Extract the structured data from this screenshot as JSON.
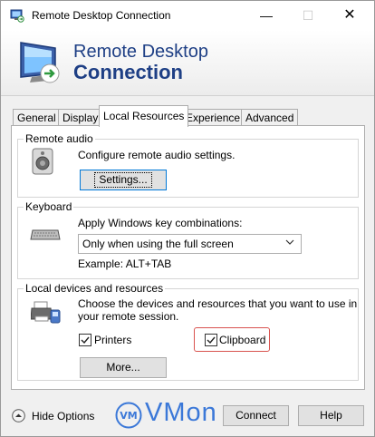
{
  "window": {
    "title": "Remote Desktop Connection",
    "controls": {
      "minimize": "—",
      "maximize": "☐",
      "close": "✕"
    }
  },
  "banner": {
    "line1": "Remote Desktop",
    "line2": "Connection"
  },
  "tabs": [
    {
      "label": "General",
      "active": false
    },
    {
      "label": "Display",
      "active": false
    },
    {
      "label": "Local Resources",
      "active": true
    },
    {
      "label": "Experience",
      "active": false
    },
    {
      "label": "Advanced",
      "active": false
    }
  ],
  "remote_audio": {
    "title": "Remote audio",
    "description": "Configure remote audio settings.",
    "settings_button": "Settings..."
  },
  "keyboard": {
    "title": "Keyboard",
    "description": "Apply Windows key combinations:",
    "selected_option": "Only when using the full screen",
    "example": "Example: ALT+TAB"
  },
  "local_devices": {
    "title": "Local devices and resources",
    "description_line1": "Choose the devices and resources that you want to use in",
    "description_line2": "your remote session.",
    "printers": {
      "label": "Printers",
      "checked": true
    },
    "clipboard": {
      "label": "Clipboard",
      "checked": true
    },
    "more_button": "More..."
  },
  "footer": {
    "hide_options": "Hide Options",
    "watermark_badge": "VM",
    "watermark_text": "VMon",
    "connect_button": "Connect",
    "help_button": "Help"
  },
  "colors": {
    "banner_text": "#1e3f85",
    "watermark": "#3b78d8",
    "highlight": "#d9534f",
    "focus_border": "#0078d7"
  }
}
